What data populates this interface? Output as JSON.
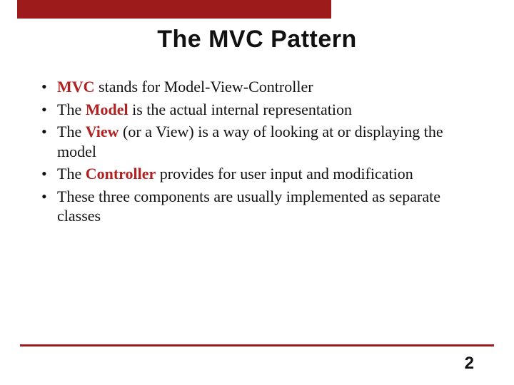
{
  "title": "The MVC Pattern",
  "bullets": [
    {
      "pre": "",
      "kw": "MVC",
      "post": " stands for Model-View-Controller"
    },
    {
      "pre": "The ",
      "kw": "Model",
      "post": " is the actual internal representation"
    },
    {
      "pre": "The ",
      "kw": "View",
      "post": " (or a View) is a way of looking at or displaying the model"
    },
    {
      "pre": "The ",
      "kw": "Controller",
      "post": " provides for user input and modification"
    },
    {
      "pre": "",
      "kw": "",
      "post": "These three components are usually implemented as separate classes"
    }
  ],
  "page_number": "2",
  "colors": {
    "accent": "#9e1b1b"
  }
}
